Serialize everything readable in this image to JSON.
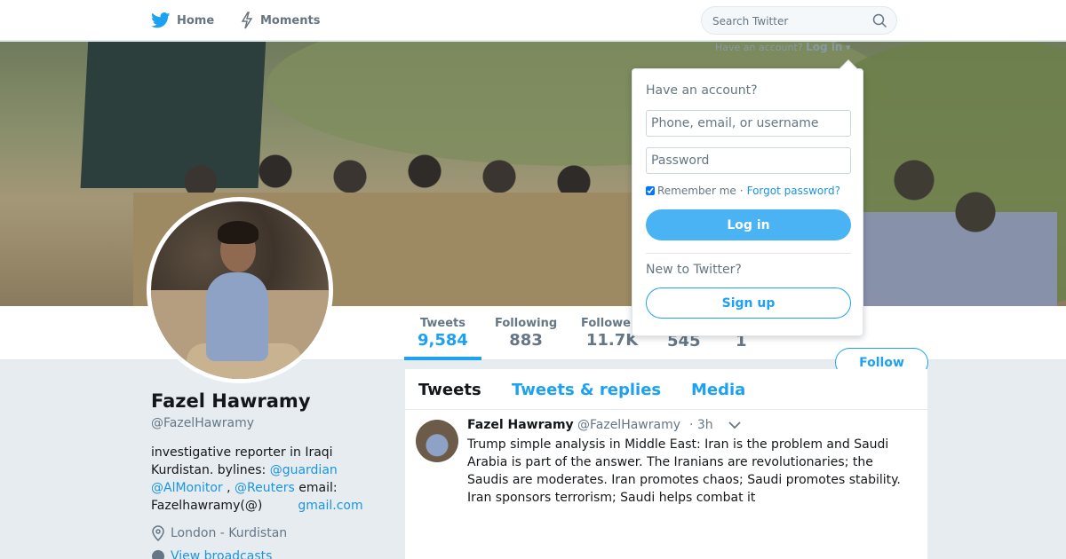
{
  "nav": {
    "home_label": "Home",
    "moments_label": "Moments",
    "search_placeholder": "Search Twitter",
    "have_account": "Have an account?",
    "login_label": "Log in",
    "login_caret": "▾"
  },
  "profile": {
    "name": "Fazel Hawramy",
    "handle": "@FazelHawramy",
    "bio_text_1": "investigative reporter in Iraqi Kurdistan. bylines: ",
    "bio_link_guardian": "@guardian",
    "bio_link_almonitor": "@AlMonitor",
    "bio_sep": " , ",
    "bio_link_reuters": "@Reuters",
    "bio_text_2": " email: Fazelhawramy(@)",
    "bio_link_gmail": "gmail.com",
    "location": "London - Kurdistan",
    "broadcasts": "View broadcasts"
  },
  "stats": [
    {
      "label": "Tweets",
      "value": "9,584"
    },
    {
      "label": "Following",
      "value": "883"
    },
    {
      "label": "Followers",
      "value": "11.7K"
    },
    {
      "label": "",
      "value": "545"
    },
    {
      "label": "",
      "value": "1"
    }
  ],
  "follow_label": "Follow",
  "tabs": [
    "Tweets",
    "Tweets & replies",
    "Media"
  ],
  "tweet": {
    "name": "Fazel Hawramy",
    "handle": "@FazelHawramy",
    "time": "· 3h",
    "text": "Trump simple analysis in Middle East: Iran is the problem and Saudi Arabia is part of the answer. The Iranians are revolutionaries; the Saudis are moderates. Iran promotes chaos; Saudi promotes stability. Iran sponsors terrorism; Saudi helps combat it"
  },
  "login_dropdown": {
    "title": "Have an account?",
    "username_placeholder": "Phone, email, or username",
    "password_placeholder": "Password",
    "remember": "Remember me",
    "forgot": "Forgot password?",
    "login_button": "Log in",
    "new_to": "New to Twitter?",
    "signup_button": "Sign up"
  },
  "colors": {
    "accent": "#1da1f2",
    "link": "#1b95e0",
    "muted": "#657786",
    "background": "#e6ecf0"
  }
}
